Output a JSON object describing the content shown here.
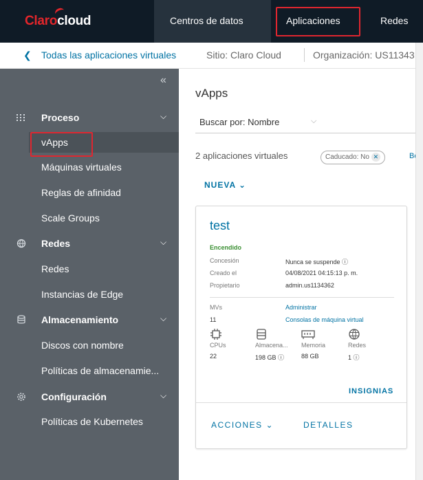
{
  "header": {
    "logo_brand": "Claro",
    "logo_product": "cloud",
    "nav": [
      {
        "label": "Centros de datos"
      },
      {
        "label": "Aplicaciones"
      },
      {
        "label": "Redes"
      }
    ]
  },
  "breadcrumb": {
    "back_label": "Todas las aplicaciones virtuales",
    "site": "Sitio: Claro Cloud",
    "org": "Organización: US11343"
  },
  "sidebar": {
    "collapse_glyph": "«",
    "sections": [
      {
        "label": "Proceso",
        "icon": "grid-icon",
        "items": [
          "vApps",
          "Máquinas virtuales",
          "Reglas de afinidad",
          "Scale Groups"
        ]
      },
      {
        "label": "Redes",
        "icon": "network-icon",
        "items": [
          "Redes",
          "Instancias de Edge"
        ]
      },
      {
        "label": "Almacenamiento",
        "icon": "database-icon",
        "items": [
          "Discos con nombre",
          "Políticas de almacenamie..."
        ]
      },
      {
        "label": "Configuración",
        "icon": "gear-icon",
        "items": [
          "Políticas de Kubernetes"
        ]
      }
    ]
  },
  "main": {
    "title": "vApps",
    "search_label": "Buscar por: Nombre",
    "count_label": "2 aplicaciones virtuales",
    "filter_chip": "Caducado: No",
    "filter_extra": "Bo",
    "new_button": "NUEVA"
  },
  "card": {
    "title": "test",
    "status": "Encendido",
    "rows": [
      {
        "key": "Concesión",
        "value": "Nunca se suspende ⓘ"
      },
      {
        "key": "Creado el",
        "value": "04/08/2021 04:15:13 p. m."
      },
      {
        "key": "Propietario",
        "value": "admin.us1134362"
      }
    ],
    "vm_key": "MVs",
    "vm_count": "11",
    "vm_manage": "Administrar",
    "vm_consoles": "Consolas de máquina virtual",
    "resources": [
      {
        "icon": "cpu-icon",
        "label": "CPUs",
        "value": "22"
      },
      {
        "icon": "storage-icon",
        "label": "Almacena...",
        "value": "198 GB ⓘ"
      },
      {
        "icon": "memory-icon",
        "label": "Memoria",
        "value": "88 GB"
      },
      {
        "icon": "network-icon",
        "label": "Redes",
        "value": "1 ⓘ"
      }
    ],
    "badges_link": "INSIGNIAS",
    "actions_button": "ACCIONES",
    "details_button": "DETALLES"
  },
  "colors": {
    "topbar": "#0f1b26",
    "sidebar": "#5a6168",
    "accent": "#0072a3",
    "brand_red": "#e3262b",
    "highlight_red": "#e0262f",
    "status_green": "#3a8f32"
  }
}
